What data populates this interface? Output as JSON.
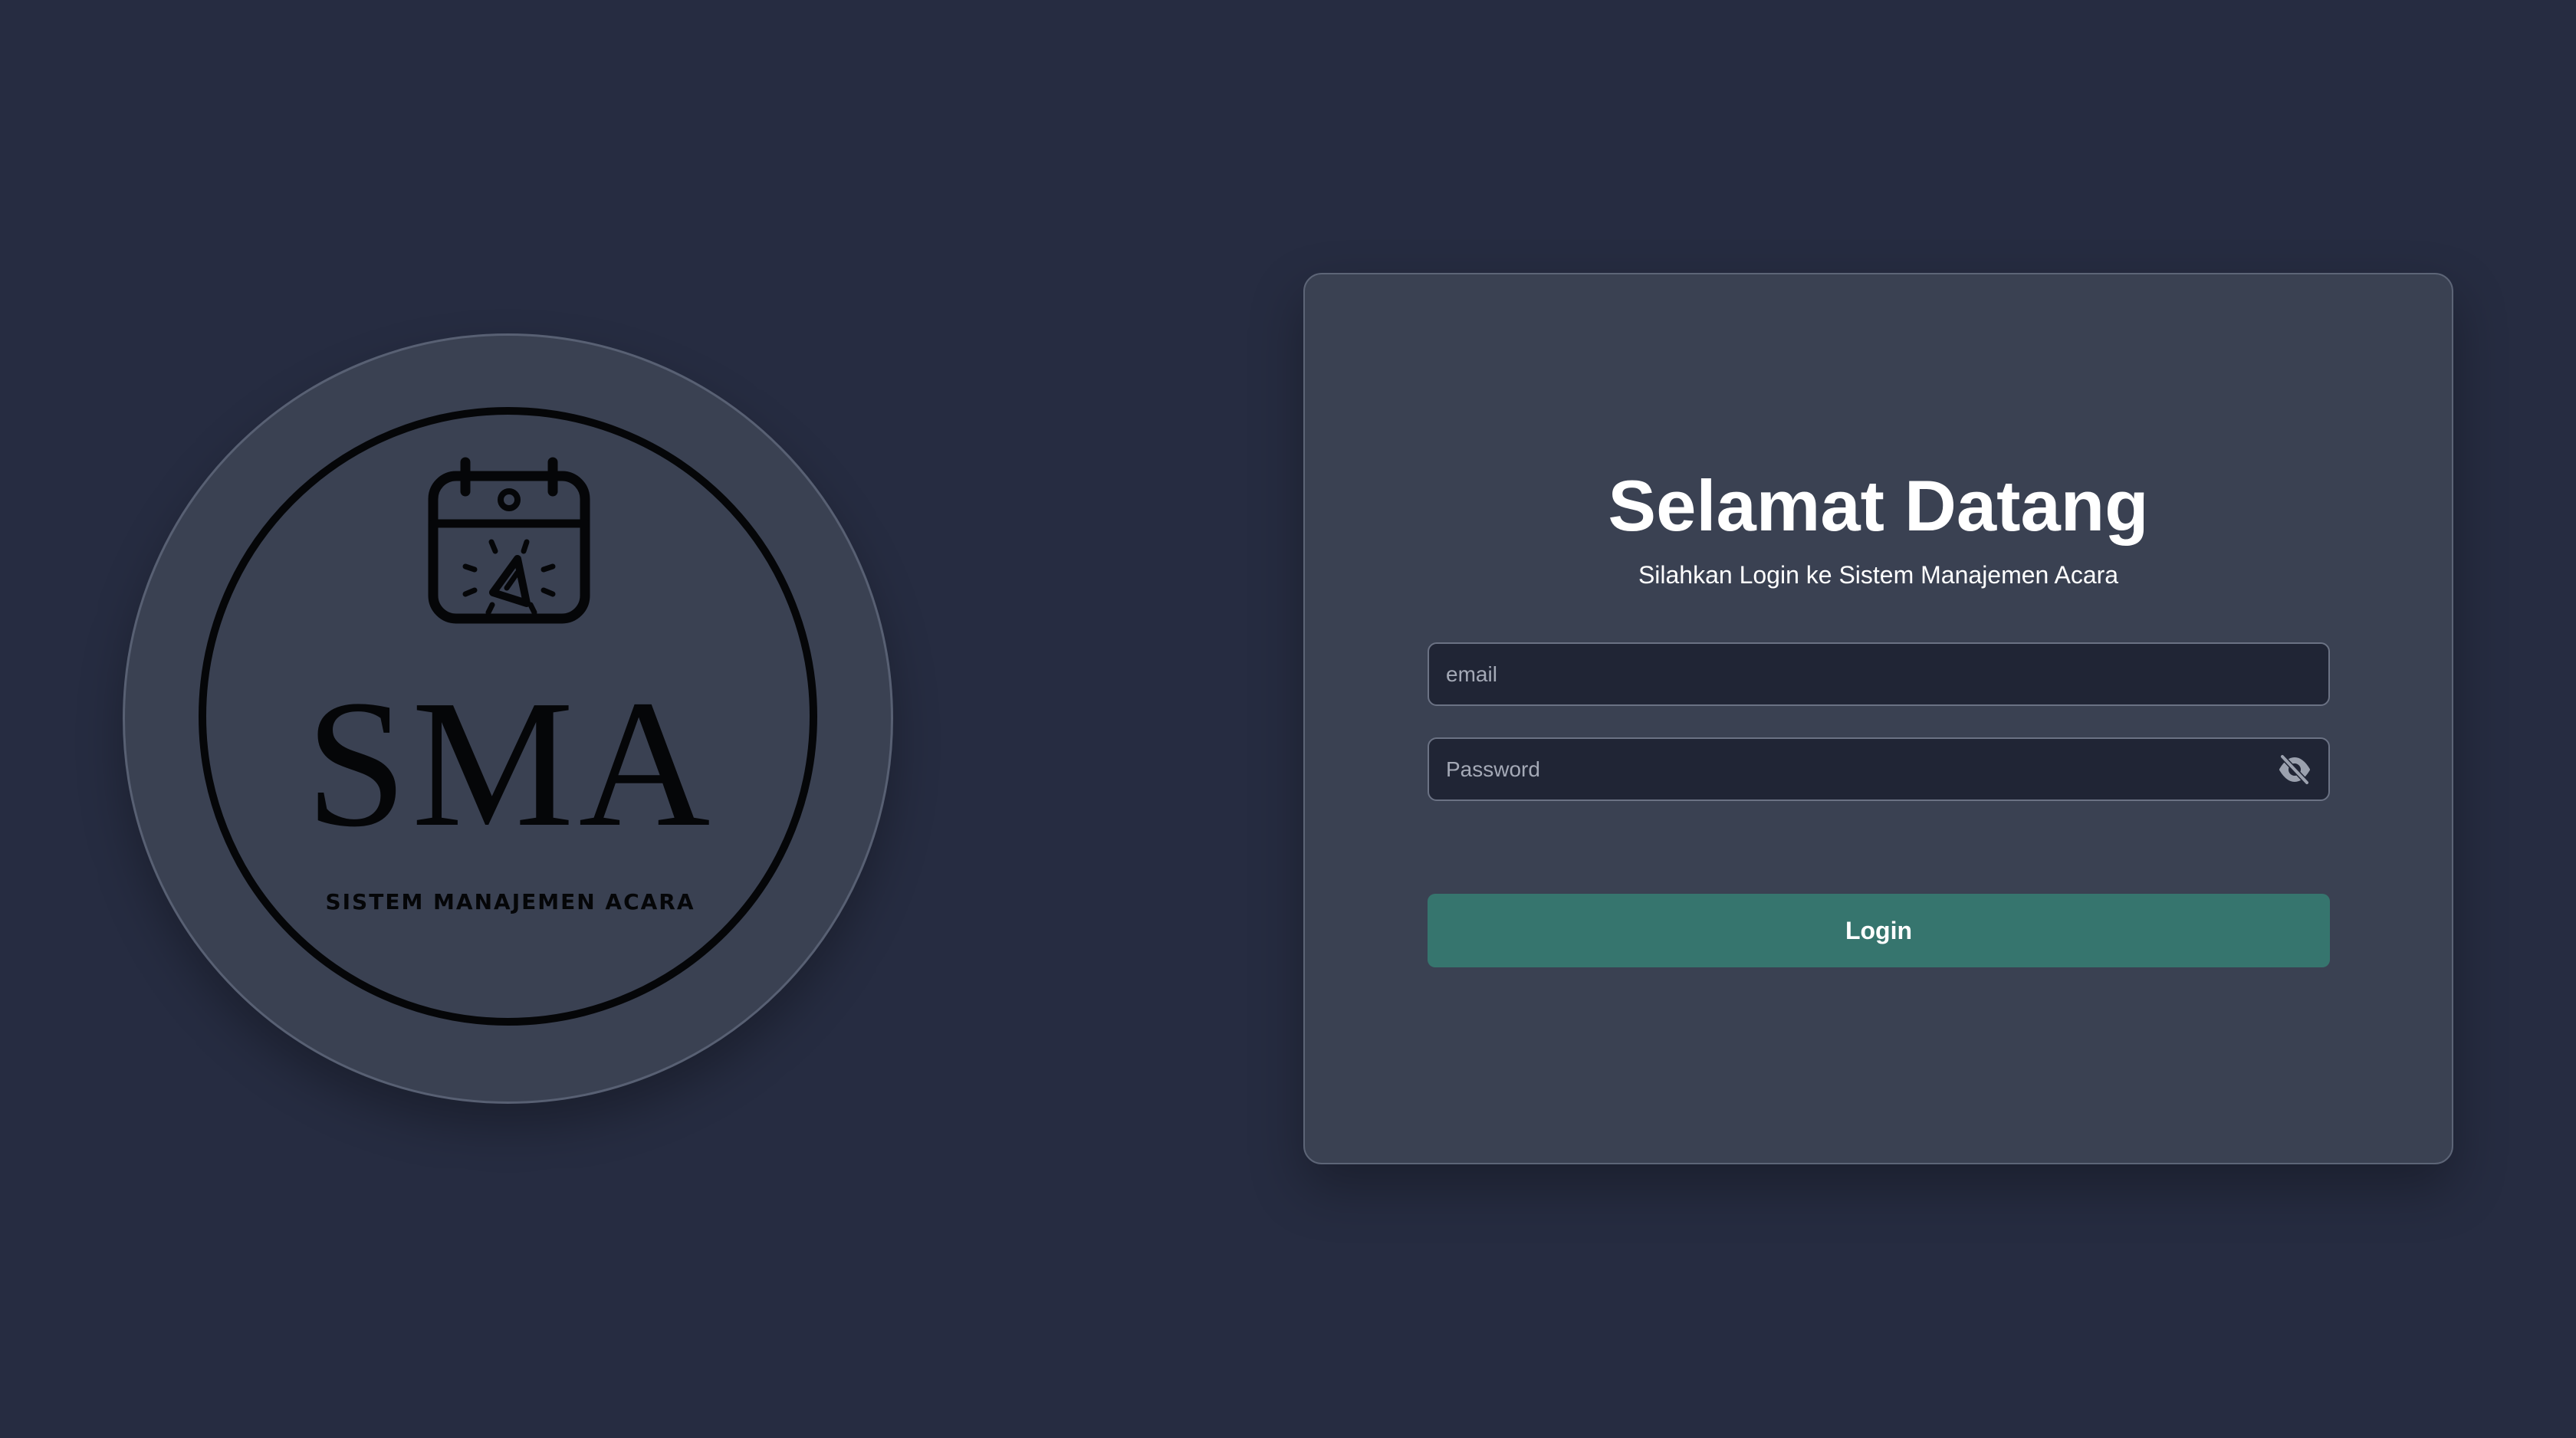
{
  "logo": {
    "title": "SMA",
    "subtitle": "SISTEM MANAJEMEN ACARA",
    "icon": "calendar-party-icon"
  },
  "login": {
    "title": "Selamat Datang",
    "subtitle": "Silahkan Login ke Sistem Manajemen Acara",
    "email_placeholder": "email",
    "password_placeholder": "Password",
    "password_toggle_icon": "eye-off-icon",
    "submit_label": "Login"
  },
  "colors": {
    "background": "#262c41",
    "card": "#3a4152",
    "input": "#202535",
    "button": "#36756e",
    "text": "#ffffff"
  }
}
